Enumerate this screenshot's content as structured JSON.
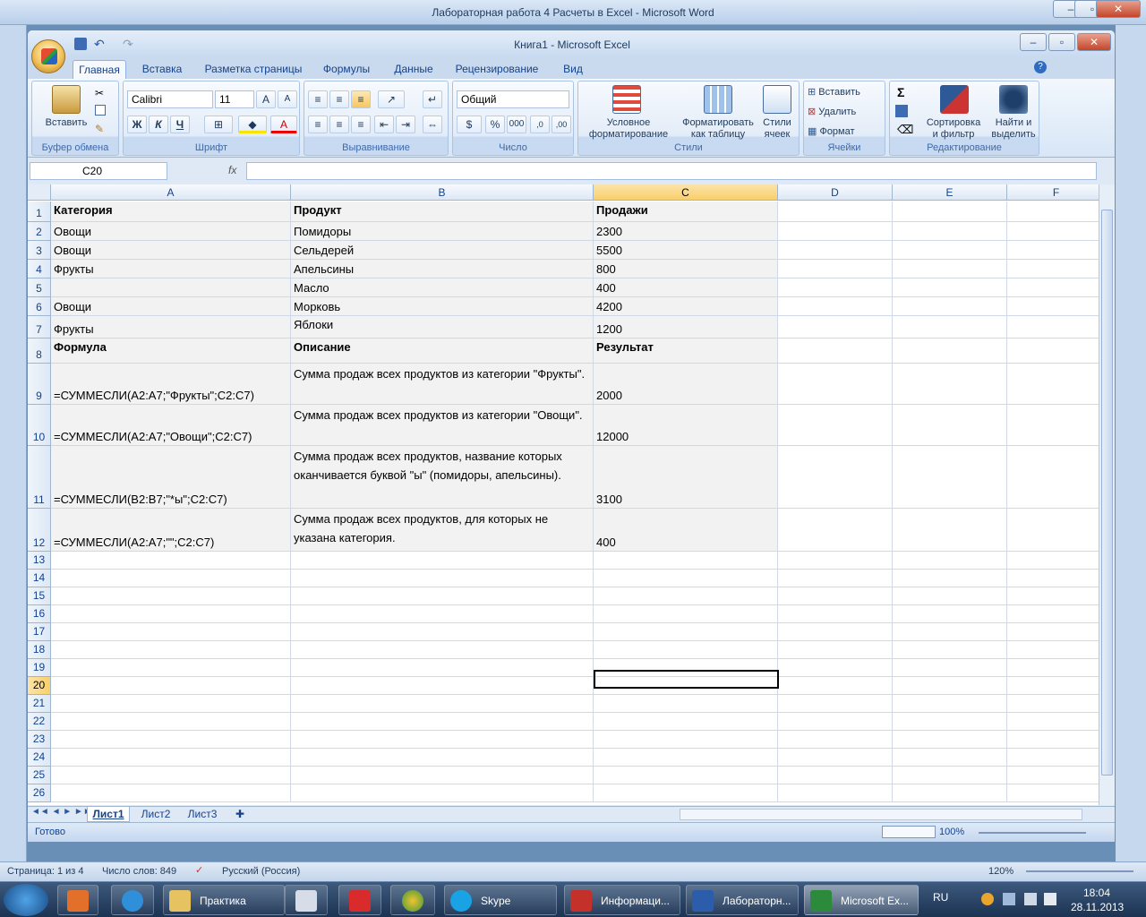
{
  "word": {
    "title": "Лабораторная  работа 4  Расчеты  в  Excel  -  Microsoft Word",
    "status": {
      "page": "Страница: 1 из 4",
      "words": "Число слов: 849",
      "lang": "Русский (Россия)",
      "zoom": "120%"
    }
  },
  "excel": {
    "title": "Книга1 - Microsoft Excel",
    "tabs": [
      "Главная",
      "Вставка",
      "Разметка страницы",
      "Формулы",
      "Данные",
      "Рецензирование",
      "Вид"
    ],
    "ribbon": {
      "clipboard": {
        "paste": "Вставить",
        "label": "Буфер обмена"
      },
      "font": {
        "name": "Calibri",
        "size": "11",
        "bold": "Ж",
        "italic": "К",
        "underline": "Ч",
        "label": "Шрифт"
      },
      "alignment": {
        "label": "Выравнивание"
      },
      "number": {
        "format": "Общий",
        "label": "Число"
      },
      "styles": {
        "cond1": "Условное",
        "cond2": "форматирование",
        "table1": "Форматировать",
        "table2": "как таблицу",
        "cell1": "Стили",
        "cell2": "ячеек",
        "label": "Стили"
      },
      "cells": {
        "insert": "Вставить",
        "delete": "Удалить",
        "format": "Формат",
        "label": "Ячейки"
      },
      "editing": {
        "sort1": "Сортировка",
        "sort2": "и фильтр",
        "find1": "Найти и",
        "find2": "выделить",
        "label": "Редактирование"
      }
    },
    "namebox": "C20",
    "fx": "fx",
    "columns": [
      "A",
      "B",
      "C",
      "D",
      "E",
      "F"
    ],
    "rows": [
      {
        "n": "1",
        "a": "Категория",
        "b": "Продукт",
        "c": "Продажи"
      },
      {
        "n": "2",
        "a": "Овощи",
        "b": "Помидоры",
        "c": "2300"
      },
      {
        "n": "3",
        "a": "Овощи",
        "b": "Сельдерей",
        "c": "5500"
      },
      {
        "n": "4",
        "a": "Фрукты",
        "b": "Апельсины",
        "c": "800"
      },
      {
        "n": "5",
        "a": "",
        "b": "Масло",
        "c": "400"
      },
      {
        "n": "6",
        "a": "Овощи",
        "b": "Морковь",
        "c": "4200"
      },
      {
        "n": "7",
        "a": "Фрукты",
        "b": "Яблоки",
        "c": "1200"
      },
      {
        "n": "8",
        "a": "Формула",
        "b": "Описание",
        "c": "Результат"
      },
      {
        "n": "9",
        "a": "=СУММЕСЛИ(A2:A7;\"Фрукты\";C2:C7)",
        "b": "Сумма продаж всех продуктов из категории \"Фрукты\".",
        "c": "2000"
      },
      {
        "n": "10",
        "a": "=СУММЕСЛИ(A2:A7;\"Овощи\";C2:C7)",
        "b": "Сумма продаж всех продуктов из категории \"Овощи\".",
        "c": "12000"
      },
      {
        "n": "11",
        "a": "=СУММЕСЛИ(B2:B7;\"*ы\";C2:C7)",
        "b": "Сумма продаж всех продуктов, название которых оканчивается буквой \"ы\" (помидоры, апельсины).",
        "c": "3100"
      },
      {
        "n": "12",
        "a": "=СУММЕСЛИ(A2:A7;\"\";C2:C7)",
        "b": "Сумма продаж всех продуктов, для которых не указана категория.",
        "c": "400"
      }
    ],
    "empty_rows": [
      "13",
      "14",
      "15",
      "16",
      "17",
      "18",
      "19",
      "20",
      "21",
      "22",
      "23",
      "24",
      "25",
      "26"
    ],
    "sheets": [
      "Лист1",
      "Лист2",
      "Лист3"
    ],
    "status": "Готово",
    "zoom": "100%"
  },
  "taskbar": {
    "items": [
      "Практика",
      "Skype",
      "Информаци...",
      "Лабораторн...",
      "Microsoft Ex..."
    ],
    "lang": "RU",
    "time": "18:04",
    "date": "28.11.2013"
  }
}
